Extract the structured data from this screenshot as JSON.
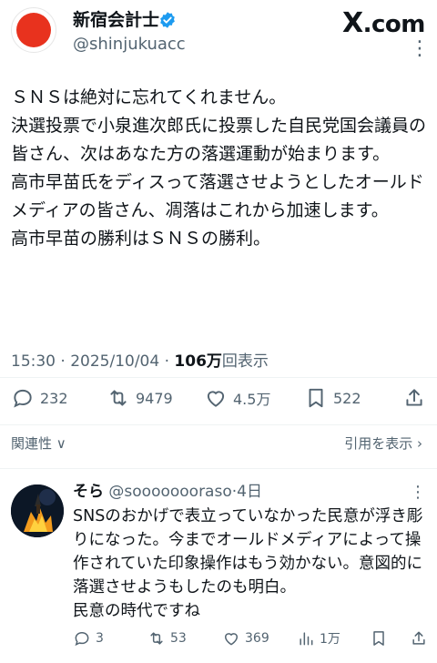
{
  "author": {
    "display_name": "新宿会計士",
    "handle": "@shinjukuacc"
  },
  "brand": {
    "x": "X",
    "dotcom": ".com"
  },
  "post": {
    "paragraphs": [
      "ＳＮＳは絶対に忘れてくれません。",
      "決選投票で小泉進次郎氏に投票した自民党国会議員の皆さん、次はあなた方の落選運動が始まります。",
      "高市早苗氏をディスって落選させようとしたオールドメディアの皆さん、凋落はこれから加速します。",
      "高市早苗の勝利はＳＮＳの勝利。"
    ],
    "time": "15:30 · 2025/10/04 · ",
    "views_count": "106万",
    "views_label": "回表示"
  },
  "actions": {
    "replies": "232",
    "reposts": "9479",
    "likes": "4.5万",
    "bookmarks": "522"
  },
  "sort": {
    "relevance": "関連性",
    "quotes": "引用を表示"
  },
  "reply": {
    "name": "そら",
    "handle": "@soooooooraso",
    "time": "·4日",
    "text_lines": [
      "SNSのおかげで表立っていなかった民意が浮き彫りになった。今までオールドメディアによって操作されていた印象操作はもう効かない。意図的に落選させようもしたのも明白。",
      "民意の時代ですね"
    ],
    "replies": "3",
    "reposts": "53",
    "likes": "369",
    "views": "1万"
  },
  "colors": {
    "verified_blue": "#1d9bf0",
    "secondary_text": "#536471",
    "primary_text": "#0f1419",
    "avatar_sun": "#e8321e"
  }
}
